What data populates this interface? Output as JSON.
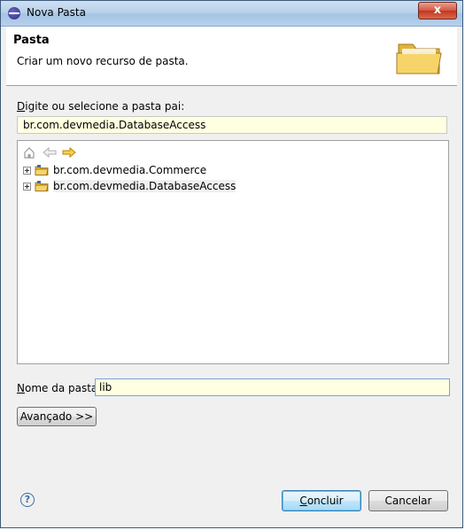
{
  "window": {
    "title": "Nova Pasta",
    "close_label": "x"
  },
  "header": {
    "title": "Pasta",
    "description": "Criar um novo recurso de pasta."
  },
  "parent": {
    "label_underlined": "D",
    "label_rest": "igite ou selecione a pasta pai:",
    "value": "br.com.devmedia.DatabaseAccess"
  },
  "tree": {
    "items": [
      {
        "label": "br.com.devmedia.Commerce"
      },
      {
        "label": "br.com.devmedia.DatabaseAccess"
      }
    ]
  },
  "folder_name": {
    "label_underlined": "N",
    "label_rest": "ome da pasta:",
    "value": "lib"
  },
  "buttons": {
    "advanced_label": "Avançado >>",
    "finish_underlined": "C",
    "finish_rest": "oncluir",
    "cancel_label": "Cancelar",
    "help_label": "?"
  },
  "colors": {
    "field_bg": "#ffffe1",
    "folder": "#f5c84a"
  }
}
